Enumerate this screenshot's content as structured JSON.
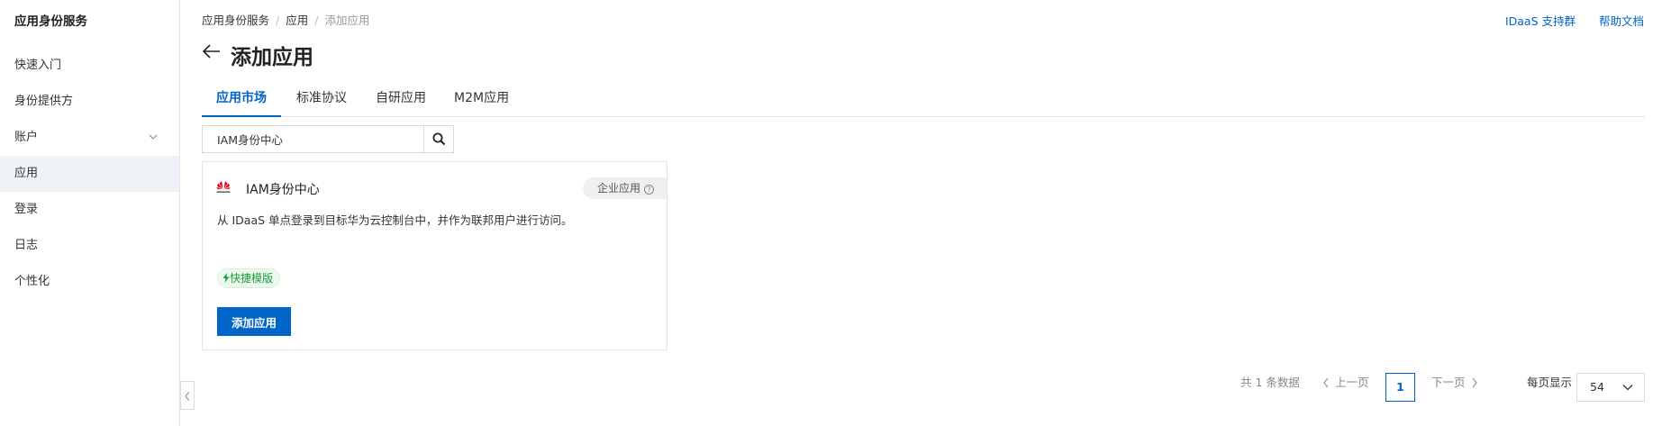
{
  "sidebar": {
    "title": "应用身份服务",
    "items": [
      {
        "label": "快速入门"
      },
      {
        "label": "身份提供方"
      },
      {
        "label": "账户"
      },
      {
        "label": "应用"
      },
      {
        "label": "登录"
      },
      {
        "label": "日志"
      },
      {
        "label": "个性化"
      }
    ],
    "active_index": 3
  },
  "breadcrumb": [
    "应用身份服务",
    "应用",
    "添加应用"
  ],
  "top_links": [
    "IDaaS 支持群",
    "帮助文档"
  ],
  "page_title": "添加应用",
  "tabs": [
    {
      "label": "应用市场",
      "active": true
    },
    {
      "label": "标准协议"
    },
    {
      "label": "自研应用"
    },
    {
      "label": "M2M应用"
    }
  ],
  "search": {
    "value": "IAM身份中心"
  },
  "card": {
    "name": "IAM身份中心",
    "badge": "企业应用",
    "description": "从 IDaaS 单点登录到目标华为云控制台中，并作为联邦用户进行访问。",
    "tag": "快捷模版",
    "button": "添加应用"
  },
  "pagination": {
    "total_text": "共 1 条数据",
    "prev": "上一页",
    "current_page": "1",
    "next": "下一页",
    "per_page_label": "每页显示",
    "per_page_value": "54"
  },
  "colors": {
    "accent": "#0064c8",
    "tag_green": "#1a9a3a",
    "huawei_red": "#e60012"
  }
}
